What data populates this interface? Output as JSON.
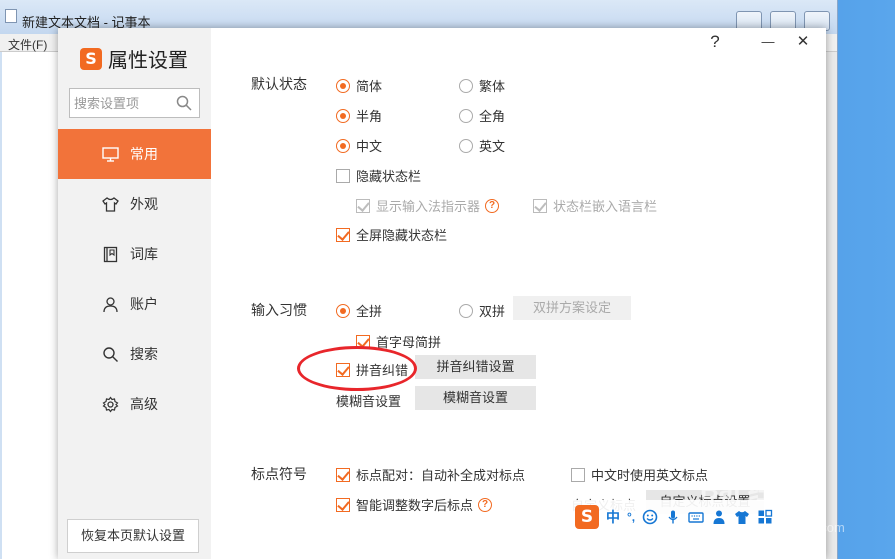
{
  "notepad": {
    "title": "新建文本文档 - 记事本",
    "menu_file": "文件(F)"
  },
  "dialog": {
    "brand_logo": "S",
    "title": "属性设置",
    "help_label": "?",
    "minimize_label": "—",
    "close_label": "✕",
    "search_placeholder": "搜索设置项",
    "nav": [
      {
        "label": "常用",
        "icon": "monitor-icon",
        "active": true
      },
      {
        "label": "外观",
        "icon": "shirt-icon"
      },
      {
        "label": "词库",
        "icon": "book-icon"
      },
      {
        "label": "账户",
        "icon": "user-icon"
      },
      {
        "label": "搜索",
        "icon": "search-icon"
      },
      {
        "label": "高级",
        "icon": "gear-icon"
      }
    ],
    "reset_label": "恢复本页默认设置"
  },
  "default_state": {
    "label": "默认状态",
    "simplified": "简体",
    "traditional": "繁体",
    "half_width": "半角",
    "full_width": "全角",
    "chinese": "中文",
    "english": "英文",
    "hide_status_bar": "隐藏状态栏",
    "show_indicator": "显示输入法指示器",
    "embed_language_bar": "状态栏嵌入语言栏",
    "fullscreen_hide": "全屏隐藏状态栏"
  },
  "input_habit": {
    "label": "输入习惯",
    "quanpin": "全拼",
    "shuangpin": "双拼",
    "shuangpin_scheme_btn": "双拼方案设定",
    "initial_jianpin": "首字母简拼",
    "pinyin_correction": "拼音纠错",
    "pinyin_correction_btn": "拼音纠错设置",
    "fuzzy_label": "模糊音设置",
    "fuzzy_btn": "模糊音设置"
  },
  "punctuation": {
    "label": "标点符号",
    "pairing": "标点配对：自动补全成对标点",
    "english_punct": "中文时使用英文标点",
    "smart_adjust": "智能调整数字后标点",
    "custom_label": "自定义标点",
    "custom_btn": "自定义标点设置"
  },
  "ime_bar": {
    "logo": "S",
    "mode": "中",
    "punct": "°,",
    "icons": [
      "smile-icon",
      "mic-icon",
      "keyboard-icon",
      "person-icon",
      "shirt-icon",
      "grid-icon"
    ]
  },
  "watermark": {
    "text": "Bai 经验",
    "sub": "jingyan.baidu.com"
  },
  "colors": {
    "accent": "#f26a21",
    "active_nav": "#f2733a",
    "annotation": "#e8262b"
  }
}
